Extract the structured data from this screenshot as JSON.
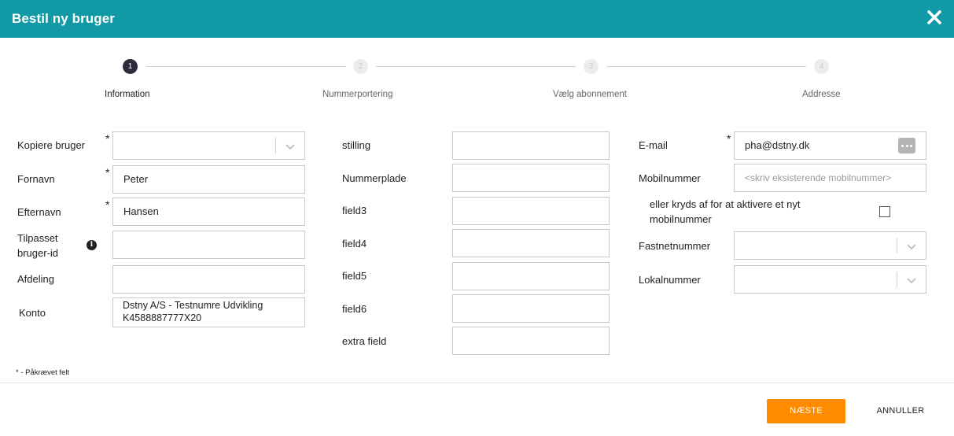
{
  "dialog": {
    "title": "Bestil ny bruger",
    "close_icon": "close-icon"
  },
  "steps": [
    {
      "number": "1",
      "label": "Information",
      "active": true
    },
    {
      "number": "2",
      "label": "Nummerportering",
      "active": false
    },
    {
      "number": "3",
      "label": "Vælg abonnement",
      "active": false
    },
    {
      "number": "4",
      "label": "Addresse",
      "active": false
    }
  ],
  "required_marker": "*",
  "left_column": {
    "kopiere_bruger": {
      "label": "Kopiere bruger",
      "value": ""
    },
    "fornavn": {
      "label": "Fornavn",
      "value": "Peter"
    },
    "efternavn": {
      "label": "Efternavn",
      "value": "Hansen"
    },
    "tilpasset": {
      "label_line1": "Tilpasset",
      "label_line2": "bruger-id",
      "value": "",
      "info_glyph": "i"
    },
    "afdeling": {
      "label": "Afdeling",
      "value": ""
    },
    "konto": {
      "label": "Konto",
      "value_line1": "Dstny A/S - Testnumre Udvikling",
      "value_line2": "K4588887777X20"
    }
  },
  "middle_column": {
    "stilling": {
      "label": "stilling",
      "value": ""
    },
    "nummerplade": {
      "label": "Nummerplade",
      "value": ""
    },
    "field3": {
      "label": "field3",
      "value": ""
    },
    "field4": {
      "label": "field4",
      "value": ""
    },
    "field5": {
      "label": "field5",
      "value": ""
    },
    "field6": {
      "label": "field6",
      "value": ""
    },
    "extra_field": {
      "label": "extra field",
      "value": ""
    }
  },
  "right_column": {
    "email": {
      "label": "E-mail",
      "value": "pha@dstny.dk"
    },
    "mobilnummer": {
      "label": "Mobilnummer",
      "placeholder": "<skriv eksisterende mobilnummer>"
    },
    "checkbox": {
      "label_line1": "eller kryds af for at aktivere et nyt",
      "label_line2": "mobilnummer",
      "checked": false
    },
    "fastnetnummer": {
      "label": "Fastnetnummer",
      "value": ""
    },
    "lokalnummer": {
      "label": "Lokalnummer",
      "value": ""
    }
  },
  "footnote": "* - Påkrævet felt",
  "buttons": {
    "next": "NÆSTE",
    "cancel": "ANNULLER"
  },
  "colors": {
    "header": "#119aa6",
    "primary_button": "#ff8c00",
    "active_step": "#2e2b3b"
  }
}
